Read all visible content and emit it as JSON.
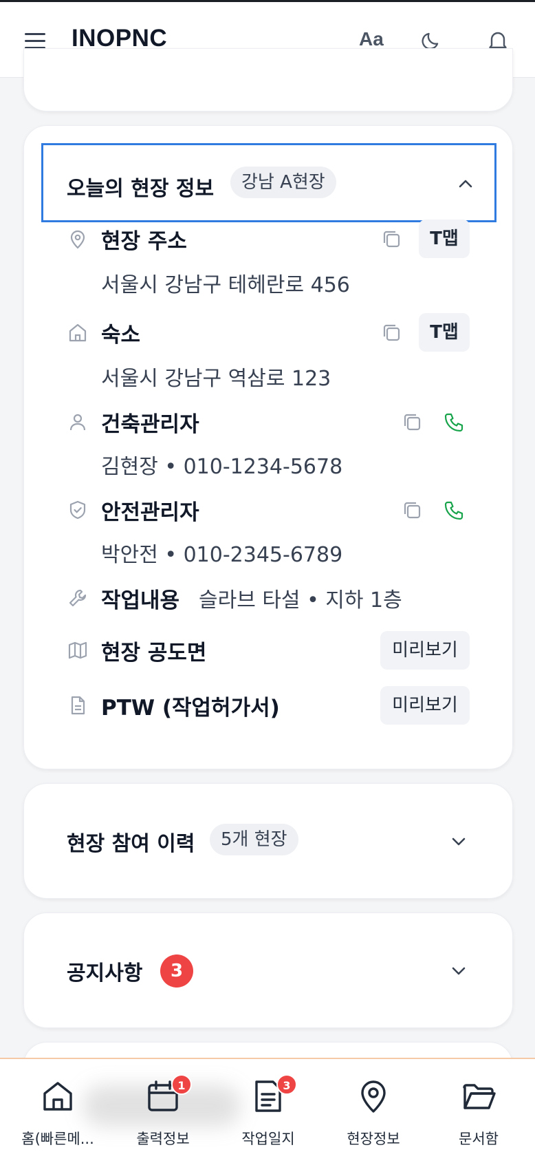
{
  "header": {
    "brand": "INOPNC",
    "font_toggle": "Aa"
  },
  "site_info": {
    "title": "오늘의 현장 정보",
    "site_chip": "강남 A현장",
    "address": {
      "label": "현장 주소",
      "value": "서울시 강남구 테헤란로 456",
      "tmap": "T맵"
    },
    "lodging": {
      "label": "숙소",
      "value": "서울시 강남구 역삼로 123",
      "tmap": "T맵"
    },
    "construction_manager": {
      "label": "건축관리자",
      "value": "김현장 • 010-1234-5678"
    },
    "safety_manager": {
      "label": "안전관리자",
      "value": "박안전 • 010-2345-6789"
    },
    "work": {
      "label": "작업내용",
      "value": "슬라브 타설 • 지하 1층"
    },
    "site_plan": {
      "label": "현장 공도면",
      "preview": "미리보기"
    },
    "ptw": {
      "label": "PTW (작업허가서)",
      "preview": "미리보기"
    }
  },
  "history": {
    "title": "현장 참여 이력",
    "chip": "5개 현장"
  },
  "notice": {
    "title": "공지사항",
    "count": "3"
  },
  "bottom_nav": {
    "items": [
      {
        "label": "홈(빠른메...",
        "icon": "home-icon",
        "badge": ""
      },
      {
        "label": "출력정보",
        "icon": "calendar-icon",
        "badge": "1"
      },
      {
        "label": "작업일지",
        "icon": "document-icon",
        "badge": "3"
      },
      {
        "label": "현장정보",
        "icon": "map-pin-icon",
        "badge": ""
      },
      {
        "label": "문서함",
        "icon": "folder-icon",
        "badge": ""
      }
    ]
  },
  "colors": {
    "accent_focus": "#2f7be0",
    "phone_green": "#16a34a",
    "badge_red": "#ef4444"
  }
}
